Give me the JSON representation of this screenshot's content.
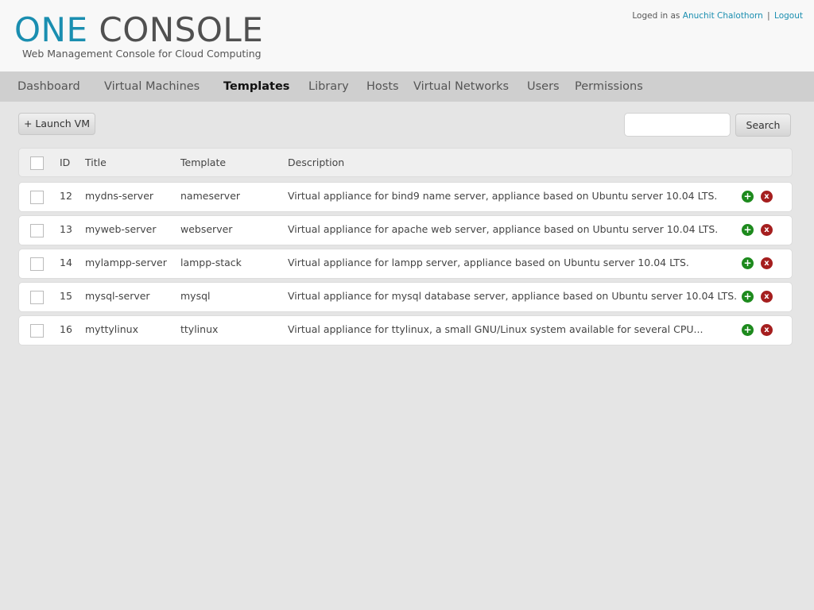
{
  "header": {
    "logo_one": "ONE",
    "logo_console": "CONSOLE",
    "tagline": "Web Management Console for Cloud Computing",
    "logged_in_prefix": "Loged in as",
    "user_name": "Anuchit Chalothorn",
    "separator": "|",
    "logout_label": "Logout"
  },
  "nav": {
    "items": [
      {
        "label": "Dashboard"
      },
      {
        "label": "Virtual Machines"
      },
      {
        "label": "Templates"
      },
      {
        "label": "Library"
      },
      {
        "label": "Hosts"
      },
      {
        "label": "Virtual Networks"
      },
      {
        "label": "Users"
      },
      {
        "label": "Permissions"
      }
    ],
    "active": "Templates"
  },
  "toolbar": {
    "launch_label": "+ Launch VM",
    "search_value": "",
    "search_label": "Search"
  },
  "table": {
    "columns": [
      "ID",
      "Title",
      "Template",
      "Description"
    ],
    "rows": [
      {
        "id": "12",
        "title": "mydns-server",
        "template": "nameserver",
        "description": "Virtual appliance for bind9 name server, appliance based on Ubuntu server 10.04 LTS."
      },
      {
        "id": "13",
        "title": "myweb-server",
        "template": "webserver",
        "description": "Virtual appliance for apache web server, appliance based on Ubuntu server 10.04 LTS."
      },
      {
        "id": "14",
        "title": "mylampp-server",
        "template": "lampp-stack",
        "description": "Virtual appliance for lampp server, appliance based on Ubuntu server 10.04 LTS."
      },
      {
        "id": "15",
        "title": "mysql-server",
        "template": "mysql",
        "description": "Virtual appliance for mysql database server, appliance based on Ubuntu server 10.04 LTS."
      },
      {
        "id": "16",
        "title": "myttylinux",
        "template": "ttylinux",
        "description": "Virtual appliance for ttylinux, a small GNU/Linux system available for several CPU..."
      }
    ],
    "row_actions": {
      "add_glyph": "+",
      "delete_glyph": "x"
    }
  },
  "colors": {
    "brand_blue": "#1a8eb0",
    "add_green": "#1d8a1d",
    "delete_red": "#a51e1e"
  }
}
